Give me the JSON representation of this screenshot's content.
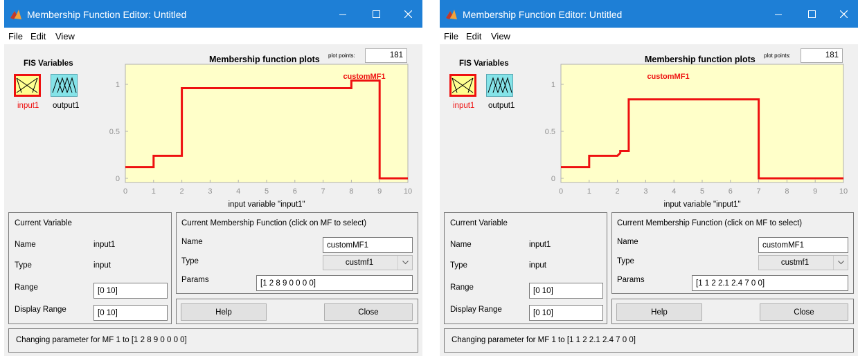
{
  "windows": [
    {
      "title": "Membership Function Editor: Untitled",
      "menu": [
        "File",
        "Edit",
        "View"
      ],
      "fis_variables_label": "FIS Variables",
      "input_label": "input1",
      "output_label": "output1",
      "plot_title": "Membership function plots",
      "plot_points_label": "plot points:",
      "plot_points": "181",
      "current_variable": {
        "header": "Current Variable",
        "name_label": "Name",
        "name": "input1",
        "type_label": "Type",
        "type": "input",
        "range_label": "Range",
        "range": "[0 10]",
        "display_range_label": "Display Range",
        "display_range": "[0 10]"
      },
      "current_mf": {
        "header": "Current Membership Function (click on MF to select)",
        "name_label": "Name",
        "name": "customMF1",
        "type_label": "Type",
        "type": "custmf1",
        "params_label": "Params",
        "params": "[1 2 8 9 0 0 0 0]"
      },
      "help_label": "Help",
      "close_label": "Close",
      "status": "Changing parameter for MF 1 to  [1 2 8 9 0 0 0 0]",
      "chart_data": {
        "type": "line",
        "title": "Membership function plots",
        "xlabel": "input variable \"input1\"",
        "ylabel": "",
        "xlim": [
          0,
          10
        ],
        "ylim": [
          0,
          1
        ],
        "xticks": [
          "0",
          "1",
          "2",
          "3",
          "4",
          "5",
          "6",
          "7",
          "8",
          "9",
          "10"
        ],
        "yticks": [
          "0",
          "0.5",
          "1"
        ],
        "series": [
          {
            "name": "customMF1",
            "color": "#ee1010",
            "x": [
              0,
              1,
              1,
              2,
              2,
              8,
              8,
              9,
              9,
              10
            ],
            "y": [
              0.12,
              0.12,
              0.24,
              0.24,
              0.96,
              0.96,
              1.04,
              1.04,
              0.0,
              0.0
            ]
          }
        ]
      }
    },
    {
      "title": "Membership Function Editor: Untitled",
      "menu": [
        "File",
        "Edit",
        "View"
      ],
      "fis_variables_label": "FIS Variables",
      "input_label": "input1",
      "output_label": "output1",
      "plot_title": "Membership function plots",
      "plot_points_label": "plot points:",
      "plot_points": "181",
      "current_variable": {
        "header": "Current Variable",
        "name_label": "Name",
        "name": "input1",
        "type_label": "Type",
        "type": "input",
        "range_label": "Range",
        "range": "[0 10]",
        "display_range_label": "Display Range",
        "display_range": "[0 10]"
      },
      "current_mf": {
        "header": "Current Membership Function (click on MF to select)",
        "name_label": "Name",
        "name": "customMF1",
        "type_label": "Type",
        "type": "custmf1",
        "params_label": "Params",
        "params": "[1 1 2 2.1 2.4 7 0 0]"
      },
      "help_label": "Help",
      "close_label": "Close",
      "status": "Changing parameter for MF 1 to  [1 1 2 2.1 2.4 7 0 0]",
      "chart_data": {
        "type": "line",
        "title": "Membership function plots",
        "xlabel": "input variable \"input1\"",
        "ylabel": "",
        "xlim": [
          0,
          10
        ],
        "ylim": [
          0,
          1
        ],
        "xticks": [
          "0",
          "1",
          "2",
          "3",
          "4",
          "5",
          "6",
          "7",
          "8",
          "9",
          "10"
        ],
        "yticks": [
          "0",
          "0.5",
          "1"
        ],
        "series": [
          {
            "name": "customMF1",
            "color": "#ee1010",
            "x": [
              0,
              1,
              1,
              2,
              2.1,
              2.1,
              2.4,
              2.4,
              7,
              7,
              10
            ],
            "y": [
              0.12,
              0.12,
              0.24,
              0.24,
              0.27,
              0.29,
              0.29,
              0.84,
              0.84,
              0.0,
              0.0
            ]
          }
        ]
      }
    }
  ]
}
